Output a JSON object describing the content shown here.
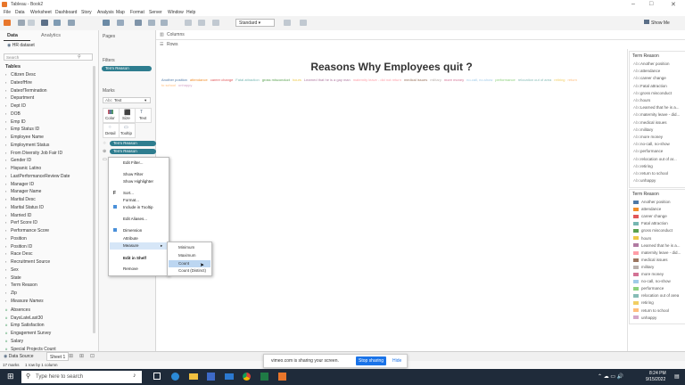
{
  "window": {
    "title": "Tableau - Book2"
  },
  "menu": [
    "File",
    "Data",
    "Worksheet",
    "Dashboard",
    "Story",
    "Analysis",
    "Map",
    "Format",
    "Server",
    "Window",
    "Help"
  ],
  "toolbar": {
    "fit_label": "Standard",
    "show_me": "Show Me"
  },
  "data_pane": {
    "tab_data": "Data",
    "tab_analytics": "Analytics",
    "datasource": "HR dataset",
    "search_placeholder": "Search",
    "tables_label": "Tables",
    "fields": [
      "Citizen Desc",
      "DateofHire",
      "DateofTermination",
      "Department",
      "Dept ID",
      "DOB",
      "Emp ID",
      "Emp Status ID",
      "Employee Name",
      "Employment Status",
      "From Diversity Job Fair ID",
      "Gender ID",
      "Hispanic Latino",
      "LastPerformanceReview Date",
      "Manager ID",
      "Manager Name",
      "Marital Desc",
      "Marital Status ID",
      "Married ID",
      "Perf Score ID",
      "Performance Score",
      "Position",
      "Position ID",
      "Race Desc",
      "Recruitment Source",
      "Sex",
      "State",
      "Term Reason",
      "Zip"
    ],
    "measure_names": "Measure Names",
    "measures": [
      "Absences",
      "DaysLateLast30",
      "Emp Satisfaction",
      "Engagement Survey",
      "Salary",
      "Special Projects Count",
      "Termd"
    ]
  },
  "shelves": {
    "pages": "Pages",
    "filters": "Filters",
    "filter_pill": "Term Reason",
    "columns": "Columns",
    "rows": "Rows",
    "marks": "Marks",
    "mark_type": "Text",
    "mark_buttons": [
      "Color",
      "Size",
      "Text",
      "Detail",
      "Tooltip"
    ],
    "mark_pills": [
      "Term Reason",
      "Term Reason"
    ]
  },
  "viz": {
    "title": "Reasons Why Employees quit ?",
    "words": [
      "Another position",
      "attendance",
      "career change",
      "Fatal attraction",
      "gross misconduct",
      "hours",
      "Learned that he is a gay man",
      "maternity leave - did not return",
      "medical issues",
      "military",
      "more money",
      "no-call, no-show",
      "performance",
      "relocation out of area",
      "retiring",
      "return to school",
      "unhappy"
    ],
    "colors": [
      "#4e79a7",
      "#f28e2b",
      "#e15759",
      "#76b7b2",
      "#59a14f",
      "#edc948",
      "#b07aa1",
      "#ff9da7",
      "#9c755f",
      "#bab0ac",
      "#d37295",
      "#a0cbe8",
      "#8cd17d",
      "#86bcb6",
      "#f1ce63",
      "#ffbe7d",
      "#d4a6c8"
    ]
  },
  "legend1": {
    "title": "Term Reason",
    "items": [
      "Another position",
      "attendance",
      "career change",
      "Fatal attraction",
      "gross misconduct",
      "hours",
      "Learned that he is a...",
      "maternity leave - did...",
      "medical issues",
      "military",
      "more money",
      "no-call, no-show",
      "performance",
      "relocation out of ar...",
      "retiring",
      "return to school",
      "unhappy"
    ]
  },
  "legend2": {
    "title": "Term Reason",
    "items": [
      "Another position",
      "attendance",
      "career change",
      "Fatal attraction",
      "gross misconduct",
      "hours",
      "Learned that he is a...",
      "maternity leave - did...",
      "medical issues",
      "military",
      "more money",
      "no-call, no-show",
      "performance",
      "relocation out of area",
      "retiring",
      "return to school",
      "unhappy"
    ]
  },
  "context_menu": {
    "items": [
      "Edit Filter...",
      "Show Filter",
      "Show Highlighter",
      "Sort...",
      "Format...",
      "Include in Tooltip",
      "Edit Aliases...",
      "Dimension",
      "Attribute",
      "Measure",
      "Edit in Shelf",
      "Remove"
    ],
    "submenu": [
      "Minimum",
      "Maximum",
      "Count",
      "Count (Distinct)"
    ]
  },
  "bottom": {
    "data_source_tab": "Data Source",
    "sheet_tab": "Sheet 1"
  },
  "status": {
    "marks": "17 marks",
    "rows": "1 row by 1 column"
  },
  "share_bar": {
    "text": "vimeo.com is sharing your screen.",
    "stop": "Stop sharing",
    "hide": "Hide"
  },
  "taskbar": {
    "search": "Type here to search",
    "time": "8:24 PM",
    "date": "9/15/2022"
  }
}
